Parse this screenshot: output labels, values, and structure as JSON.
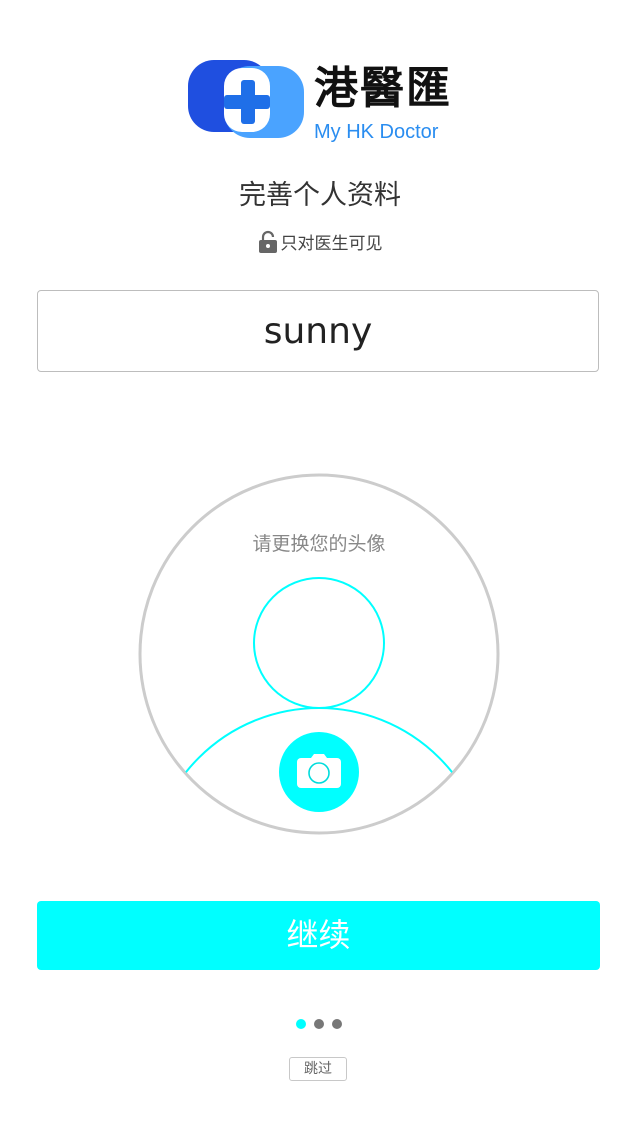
{
  "logo": {
    "name_cn": "港醫匯",
    "name_en": "My HK Doctor"
  },
  "page": {
    "title": "完善个人资料",
    "privacy_note": "只对医生可见"
  },
  "name_field": {
    "value": "sunny"
  },
  "avatar": {
    "hint": "请更换您的头像"
  },
  "actions": {
    "continue_label": "继续",
    "skip_label": "跳过"
  },
  "pager": {
    "total": 3,
    "active_index": 0
  },
  "colors": {
    "accent": "#00ffff",
    "logo_blue": "#2a8df0",
    "logo_dark_blue": "#1f4fe0",
    "dot_inactive": "#777777",
    "circle_border": "#cccccc"
  }
}
